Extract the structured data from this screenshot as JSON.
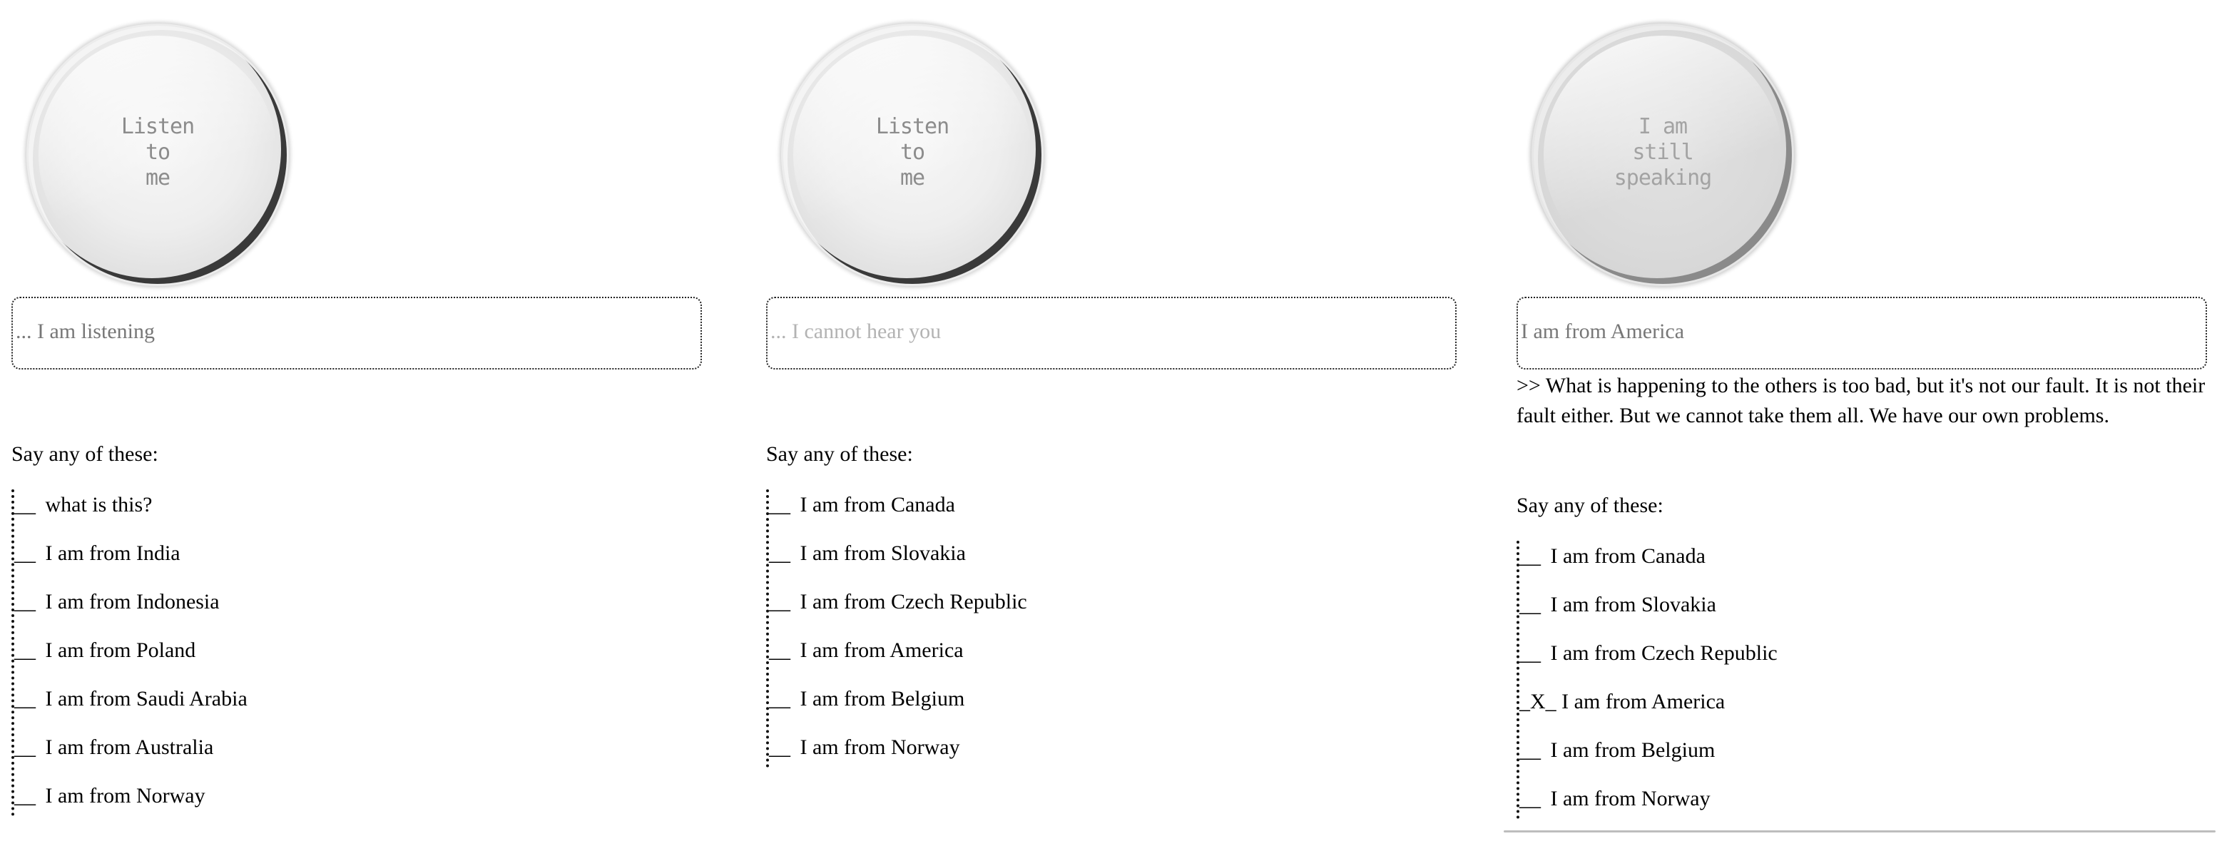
{
  "panels": [
    {
      "mic_label": "Listen\nto\nme",
      "transcript": "... I am listening",
      "say_label": "Say any of these:",
      "options": [
        {
          "mark": "__",
          "text": "what is this?"
        },
        {
          "mark": "__",
          "text": "I am from India"
        },
        {
          "mark": "__",
          "text": "I am from Indonesia"
        },
        {
          "mark": "__",
          "text": "I am from Poland"
        },
        {
          "mark": "__",
          "text": "I am from Saudi Arabia"
        },
        {
          "mark": "__",
          "text": "I am from Australia"
        },
        {
          "mark": "__",
          "text": "I am from Norway"
        }
      ]
    },
    {
      "mic_label": "Listen\nto\nme",
      "transcript": "... I cannot hear you",
      "say_label": "Say any of these:",
      "options": [
        {
          "mark": "__",
          "text": "I am from Canada"
        },
        {
          "mark": "__",
          "text": "I am from Slovakia"
        },
        {
          "mark": "__",
          "text": "I am from Czech Republic"
        },
        {
          "mark": "__",
          "text": "I am from America"
        },
        {
          "mark": "__",
          "text": "I am from Belgium"
        },
        {
          "mark": "__",
          "text": "I am from Norway"
        }
      ]
    },
    {
      "mic_label": "I am\nstill\nspeaking",
      "transcript": "I am from America",
      "response": ">> What is happening to the others is too bad, but it's not our fault. It is not their fault either. But we cannot take them all. We have our own problems.",
      "say_label": "Say any of these:",
      "options": [
        {
          "mark": "__",
          "text": "I am from Canada"
        },
        {
          "mark": "__",
          "text": "I am from Slovakia"
        },
        {
          "mark": "__",
          "text": "I am from Czech Republic"
        },
        {
          "mark": "_X_",
          "text": "I am from America"
        },
        {
          "mark": "__",
          "text": "I am from Belgium"
        },
        {
          "mark": "__",
          "text": "I am from Norway"
        }
      ]
    }
  ]
}
